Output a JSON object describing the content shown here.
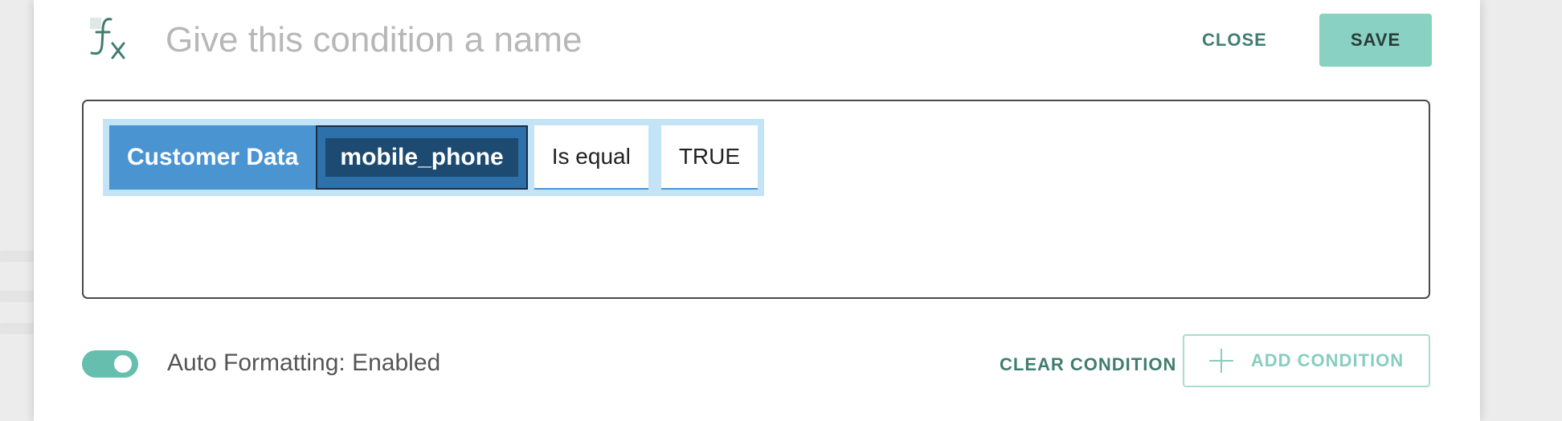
{
  "header": {
    "icon": "function-fx-icon",
    "name_placeholder": "Give this condition a name",
    "name_value": "",
    "close_label": "CLOSE",
    "save_label": "SAVE"
  },
  "condition": {
    "source": "Customer Data",
    "field": "mobile_phone",
    "operator": "Is equal",
    "value": "TRUE"
  },
  "footer": {
    "toggle_state": "on",
    "auto_formatting_label": "Auto Formatting: Enabled",
    "clear_label": "CLEAR CONDITION",
    "add_label": "ADD CONDITION",
    "add_icon": "plus-icon"
  },
  "colors": {
    "accent_teal": "#88d1c3",
    "accent_teal_dark": "#3f7d6f",
    "chip_blue": "#4a94d2",
    "chip_field": "#1c4a70",
    "row_highlight": "#c3e4f6"
  }
}
